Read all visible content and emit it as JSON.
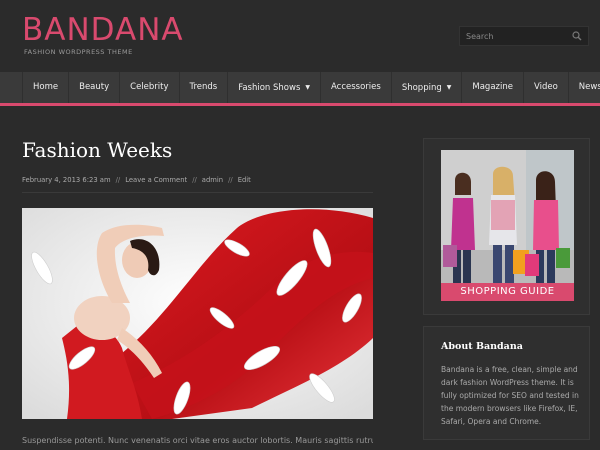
{
  "site": {
    "title": "BANDANA",
    "tagline": "FASHION WORDPRESS THEME",
    "brand_color": "#d94a6e"
  },
  "search": {
    "placeholder": "Search",
    "icon": "search-icon"
  },
  "nav": {
    "items": [
      {
        "label": "Home"
      },
      {
        "label": "Beauty"
      },
      {
        "label": "Celebrity"
      },
      {
        "label": "Trends"
      },
      {
        "label": "Fashion Shows",
        "has_submenu": true
      },
      {
        "label": "Accessories"
      },
      {
        "label": "Shopping",
        "has_submenu": true
      },
      {
        "label": "Magazine"
      },
      {
        "label": "Video"
      },
      {
        "label": "News"
      }
    ]
  },
  "post": {
    "title": "Fashion Weeks",
    "date": "February 4, 2013 6:23 am",
    "comment_link": "Leave a Comment",
    "author": "admin",
    "edit_link": "Edit",
    "separator": "//",
    "excerpt": "Suspendisse potenti. Nunc venenatis orci vitae eros auctor lobortis. Mauris sagittis rutrum"
  },
  "sidebar": {
    "ad_label": "SHOPPING GUIDE",
    "about_title": "About Bandana",
    "about_text": "Bandana is a free, clean, simple and dark fashion WordPress theme. It is fully optimized for SEO and tested in the modern browsers like Firefox, IE, Safari, Opera and Chrome."
  }
}
